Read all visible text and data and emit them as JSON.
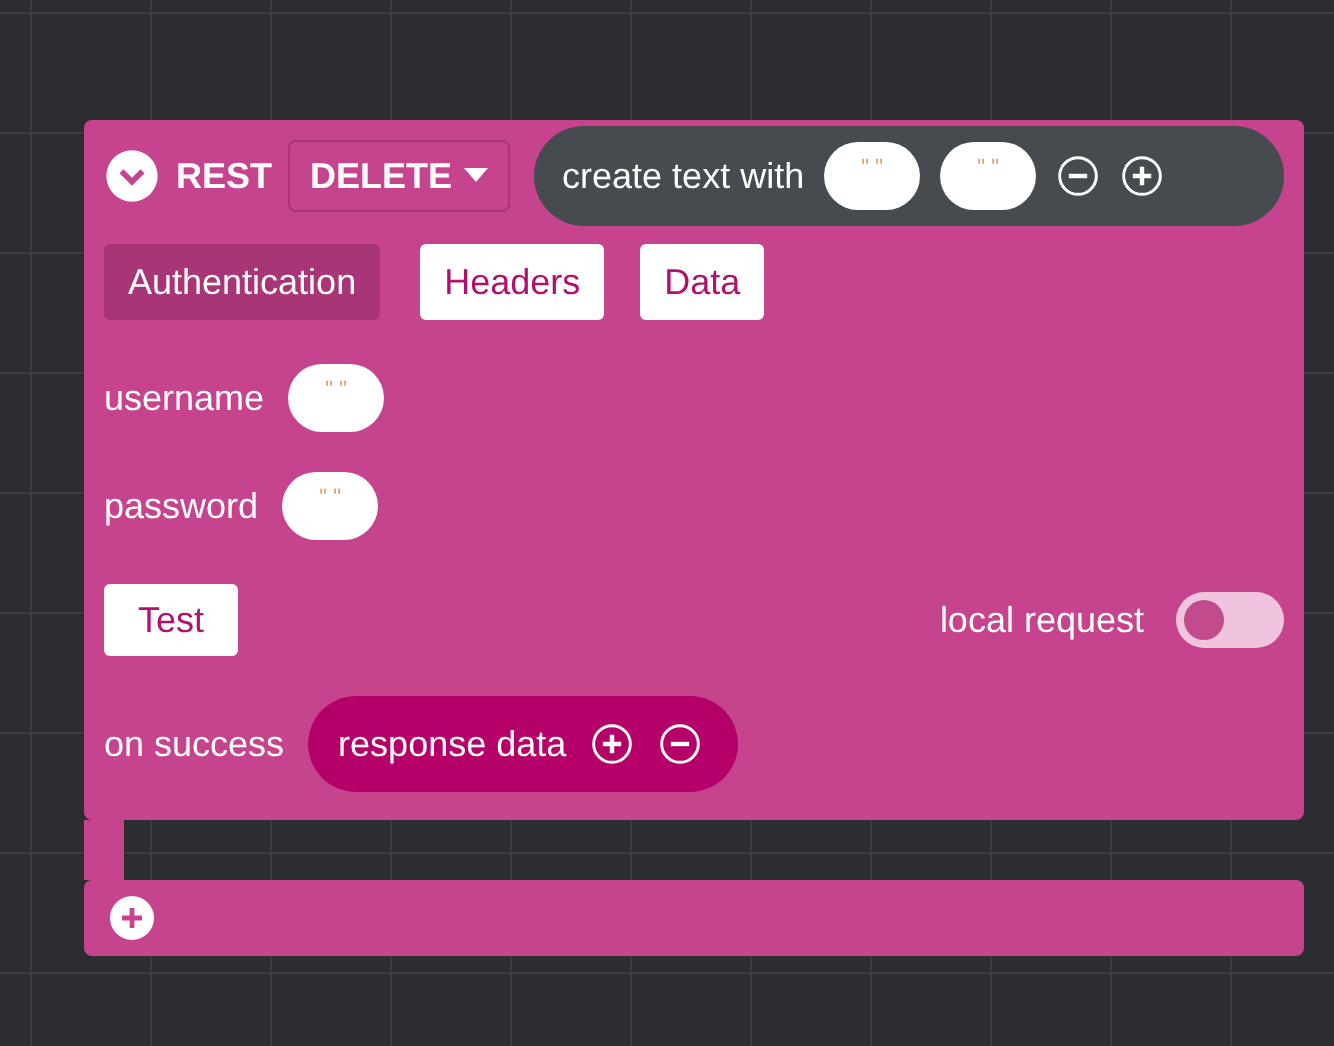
{
  "block": {
    "label": "REST",
    "method": "DELETE",
    "join": {
      "label": "create text with",
      "items": [
        "\" \"",
        "\" \""
      ]
    }
  },
  "tabs": [
    {
      "label": "Authentication",
      "selected": true
    },
    {
      "label": "Headers",
      "selected": false
    },
    {
      "label": "Data",
      "selected": false
    }
  ],
  "fields": [
    {
      "label": "username",
      "value": "\" \""
    },
    {
      "label": "password",
      "value": "\" \""
    }
  ],
  "test_button": "Test",
  "local_request": {
    "label": "local request",
    "on": false
  },
  "on_success": {
    "label": "on success",
    "param": "response data"
  }
}
